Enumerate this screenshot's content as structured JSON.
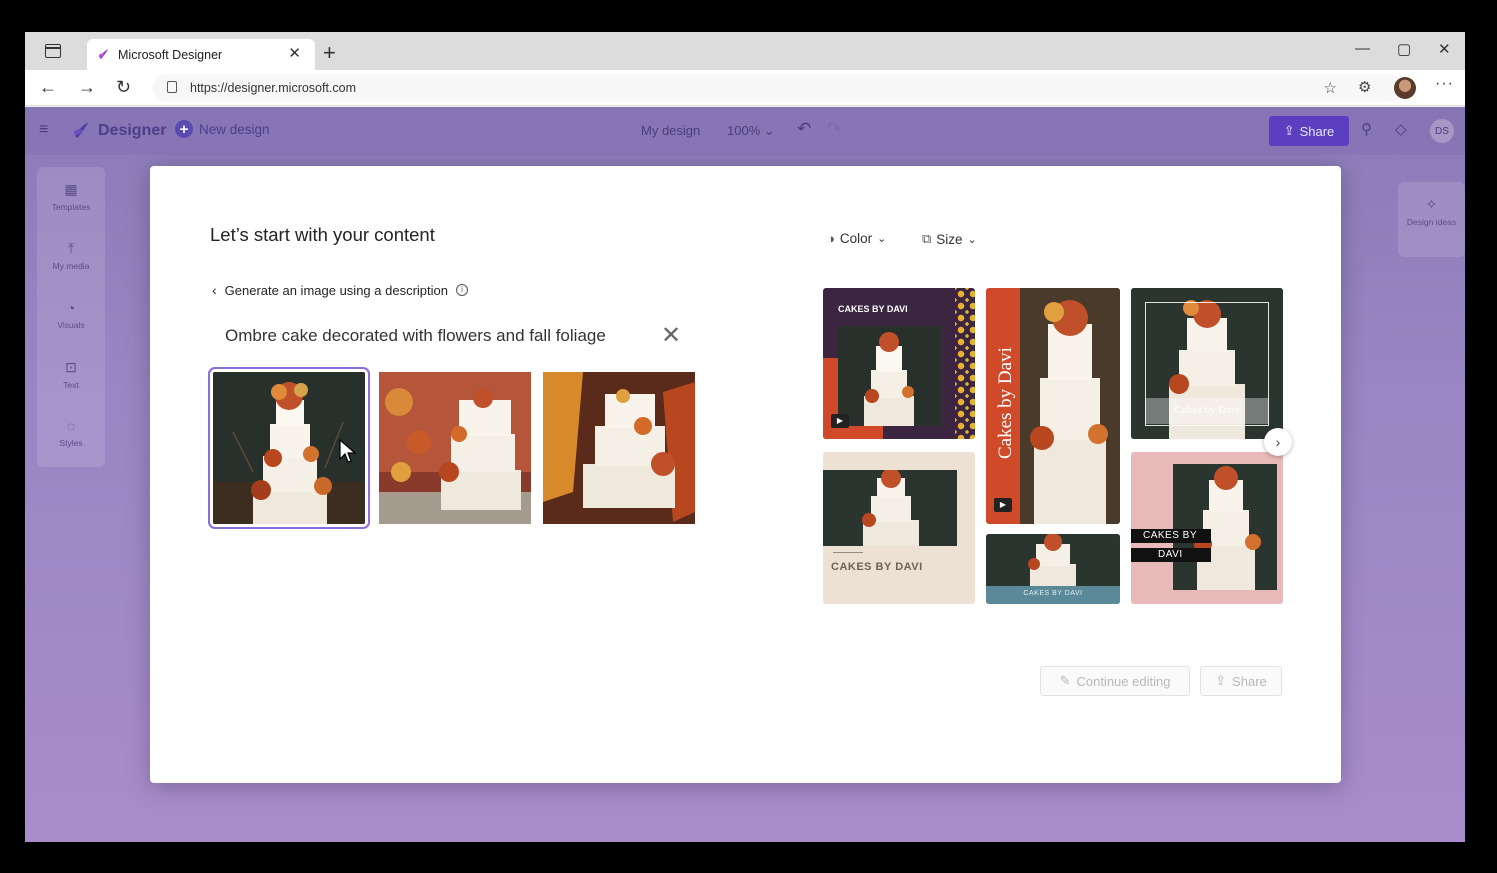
{
  "browser": {
    "tab_title": "Microsoft Designer",
    "url": "https://designer.microsoft.com",
    "new_tab": "+",
    "tab_close": "✕"
  },
  "appbar": {
    "brand": "Designer",
    "new_design": "New design",
    "design_name": "My design",
    "zoom": "100%",
    "share": "Share",
    "user_initials": "DS"
  },
  "left_rail": {
    "items": [
      {
        "label": "Templates",
        "icon": "templates-icon"
      },
      {
        "label": "My media",
        "icon": "upload-icon"
      },
      {
        "label": "Visuals",
        "icon": "shapes-icon"
      },
      {
        "label": "Text",
        "icon": "text-icon"
      },
      {
        "label": "Styles",
        "icon": "palette-icon"
      }
    ]
  },
  "right_rail": {
    "design_ideas": "Design ideas"
  },
  "modal": {
    "title": "Let’s start with your content",
    "back_link": "Generate an image using a description",
    "prompt": "Ombre cake decorated with flowers and fall foliage",
    "filters": {
      "color": "Color",
      "size": "Size"
    },
    "templates": {
      "t1": "CAKES BY DAVI",
      "t2": "Cakes by Davi",
      "t3": "Cakes by Davi",
      "t4": "CAKES BY DAVI",
      "t5": "CAKES BY DAVI",
      "t6_line1": "CAKES BY",
      "t6_line2": "DAVI"
    },
    "continue_editing": "Continue editing",
    "share": "Share"
  },
  "colors": {
    "accent": "#5a3fc0",
    "selection_outline": "#8b6de0",
    "app_background": "#9a86c4"
  }
}
